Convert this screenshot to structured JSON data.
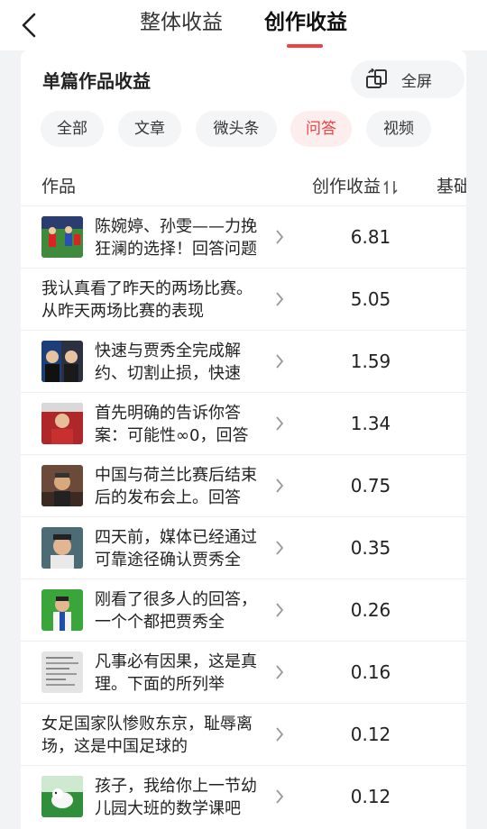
{
  "header": {
    "tabs": [
      {
        "label": "整体收益",
        "active": false
      },
      {
        "label": "创作收益",
        "active": true
      }
    ],
    "accent": "#f04142"
  },
  "card": {
    "title": "单篇作品收益",
    "fullscreen_label": "全屏",
    "filters": [
      {
        "label": "全部",
        "active": false
      },
      {
        "label": "文章",
        "active": false
      },
      {
        "label": "微头条",
        "active": false
      },
      {
        "label": "问答",
        "active": true
      },
      {
        "label": "视频",
        "active": false
      }
    ],
    "columns": {
      "work": "作品",
      "earnings": "创作收益",
      "base": "基础"
    },
    "rows": [
      {
        "title": "陈婉婷、孙雯——力挽狂澜的选择！回答问题",
        "value": "6.81",
        "thumb": "soccer-match-photo"
      },
      {
        "title": "我认真看了昨天的两场比赛。从昨天两场比赛的表现",
        "value": "5.05",
        "thumb": null
      },
      {
        "title": "快速与贾秀全完成解约、切割止损，快速",
        "value": "1.59",
        "thumb": "coach-photo"
      },
      {
        "title": "首先明确的告诉你答案：可能性∞0，回答",
        "value": "1.34",
        "thumb": "press-conference-photo"
      },
      {
        "title": "中国与荷兰比赛后结束后的发布会上。回答",
        "value": "0.75",
        "thumb": "press-conference-photo-2"
      },
      {
        "title": "四天前，媒体已经通过可靠途径确认贾秀全",
        "value": "0.35",
        "thumb": "coach-portrait"
      },
      {
        "title": "刚看了很多人的回答，一个个都把贾秀全",
        "value": "0.26",
        "thumb": "coach-on-pitch"
      },
      {
        "title": "凡事必有因果，这是真理。下面的所列举",
        "value": "0.16",
        "thumb": "document-photo"
      },
      {
        "title": "女足国家队惨败东京，耻辱离场，这是中国足球的",
        "value": "0.12",
        "thumb": null
      },
      {
        "title": "孩子，我给你上一节幼儿园大班的数学课吧",
        "value": "0.12",
        "thumb": "dog-photo"
      }
    ]
  }
}
